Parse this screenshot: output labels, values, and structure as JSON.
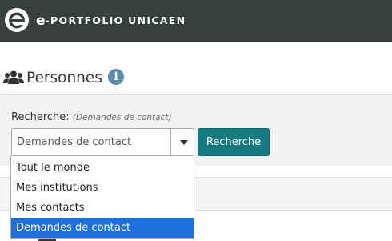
{
  "header": {
    "brand_prefix": "e",
    "brand_name": "-PORTFOLIO UNICAEN",
    "logo_icon": "e-circle-logo",
    "background_color": "#393e3e"
  },
  "page": {
    "title": "Personnes",
    "title_icon": "users-icon",
    "info_icon": "info-icon"
  },
  "search": {
    "label": "Recherche:",
    "current_filter": "(Demandes de contact)",
    "selected_value": "Demandes de contact",
    "button_label": "Recherche",
    "button_color": "#167b80"
  },
  "dropdown": {
    "options": [
      "Tout le monde",
      "Mes institutions",
      "Mes contacts",
      "Demandes de contact"
    ],
    "selected_index": 3,
    "highlight_color": "#1e6fd9"
  }
}
